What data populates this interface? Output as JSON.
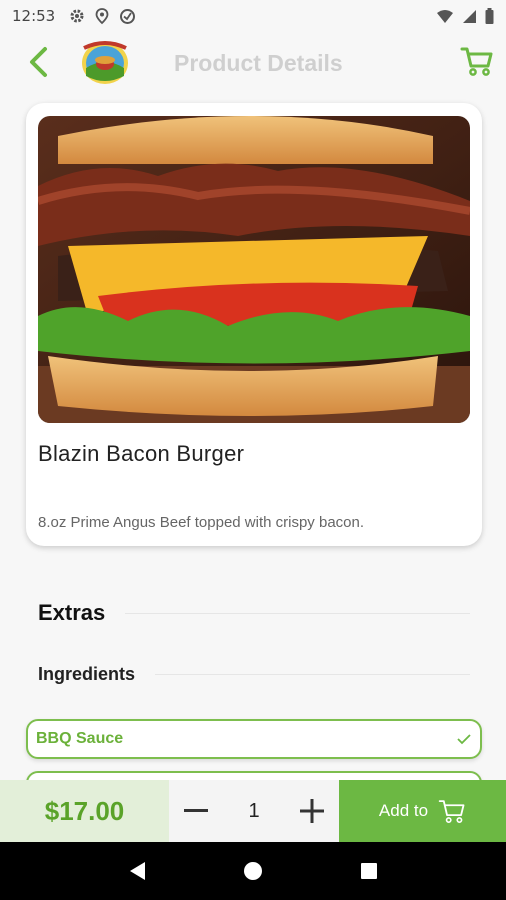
{
  "status_bar": {
    "time": "12:53",
    "left_icons": [
      "gear-icon",
      "location-icon",
      "sync-icon"
    ],
    "right_icons": [
      "wifi-icon",
      "signal-icon",
      "battery-icon"
    ]
  },
  "header": {
    "title": "Product Details",
    "accent_color": "#6cb843"
  },
  "product": {
    "name": "Blazin Bacon Burger",
    "description": "8.oz Prime Angus Beef topped with crispy bacon."
  },
  "extras": {
    "title": "Extras",
    "ingredients_title": "Ingredients",
    "options": [
      {
        "label": "BBQ Sauce",
        "selected": true
      }
    ]
  },
  "bottom_bar": {
    "price": "$17.00",
    "quantity": "1",
    "add_label": "Add to"
  },
  "colors": {
    "green": "#6cb843",
    "price_bg": "#e3efd9",
    "title_grey": "#cfcfcf"
  }
}
